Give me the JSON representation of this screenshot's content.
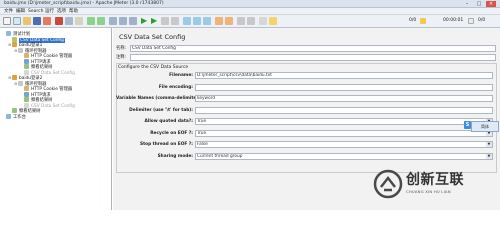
{
  "window": {
    "title": "baidu.jmx (D:\\jmeter_script\\baidu.jmx) - Apache JMeter (3.0 r1743807)"
  },
  "menu": [
    "文件",
    "编辑",
    "Search",
    "运行",
    "选项",
    "帮助"
  ],
  "toolbar": {
    "readout1": "0/0",
    "readout2": "00:00:01",
    "readout3": "0/0"
  },
  "tree": [
    {
      "label": "测试计划",
      "level": 0,
      "expander": "",
      "icon": "#8bb7e6",
      "selected": false,
      "disabled": false
    },
    {
      "label": "CSV Data Set Config",
      "level": 1,
      "expander": "",
      "icon": "#b0c76a",
      "selected": true,
      "disabled": false
    },
    {
      "label": "baidu登录1",
      "level": 1,
      "expander": "⊖",
      "icon": "#e0a23a",
      "selected": false,
      "disabled": false
    },
    {
      "label": "循环控制器",
      "level": 2,
      "expander": "⊖",
      "icon": "#c6c6c6",
      "selected": false,
      "disabled": false
    },
    {
      "label": "HTTP Cookie 管理器",
      "level": 3,
      "expander": "",
      "icon": "#d7b56d",
      "selected": false,
      "disabled": false
    },
    {
      "label": "HTTP请求",
      "level": 3,
      "expander": "",
      "icon": "#7aa1d4",
      "selected": false,
      "disabled": false
    },
    {
      "label": "察看结果树",
      "level": 3,
      "expander": "",
      "icon": "#9cc07a",
      "selected": false,
      "disabled": false
    },
    {
      "label": "CSV Data Set Config",
      "level": 3,
      "expander": "",
      "icon": "#d6d6d6",
      "selected": false,
      "disabled": true
    },
    {
      "label": "baidu登录2",
      "level": 1,
      "expander": "⊖",
      "icon": "#e0a23a",
      "selected": false,
      "disabled": false
    },
    {
      "label": "循环控制器",
      "level": 2,
      "expander": "⊖",
      "icon": "#c6c6c6",
      "selected": false,
      "disabled": false
    },
    {
      "label": "HTTP Cookie 管理器",
      "level": 3,
      "expander": "",
      "icon": "#d7b56d",
      "selected": false,
      "disabled": false
    },
    {
      "label": "HTTP请求",
      "level": 3,
      "expander": "",
      "icon": "#7aa1d4",
      "selected": false,
      "disabled": false
    },
    {
      "label": "察看结果树",
      "level": 3,
      "expander": "",
      "icon": "#9cc07a",
      "selected": false,
      "disabled": false
    },
    {
      "label": "CSV Data Set Config",
      "level": 3,
      "expander": "",
      "icon": "#d6d6d6",
      "selected": false,
      "disabled": true
    },
    {
      "label": "察看结果树",
      "level": 1,
      "expander": "",
      "icon": "#9cc07a",
      "selected": false,
      "disabled": false
    },
    {
      "label": "工作台",
      "level": 0,
      "expander": "",
      "icon": "#8bb7e6",
      "selected": false,
      "disabled": false
    }
  ],
  "panel": {
    "title": "CSV Data Set Config",
    "name_label": "名称:",
    "name_value": "CSV Data Set Config",
    "comment_label": "注释:",
    "comment_value": "",
    "group_title": "Configure the CSV Data Source",
    "fields": [
      {
        "label": "Filename:",
        "value": "D:\\jmeter_script\\csv\\data\\baidu.txt",
        "dropdown": false
      },
      {
        "label": "File encoding:",
        "value": "",
        "dropdown": false
      },
      {
        "label": "Variable Names (comma-delimited):",
        "value": "keyword",
        "dropdown": false
      },
      {
        "label": "Delimiter (use '\\t' for tab):",
        "value": "",
        "dropdown": false
      },
      {
        "label": "Allow quoted data?:",
        "value": "True",
        "dropdown": true
      },
      {
        "label": "Recycle on EOF ?:",
        "value": "True",
        "dropdown": true
      },
      {
        "label": "Stop thread on EOF ?:",
        "value": "False",
        "dropdown": true
      },
      {
        "label": "Sharing mode:",
        "value": "Current thread group",
        "dropdown": true
      }
    ]
  },
  "tooltip": {
    "icon_text": "S",
    "text": "简体"
  },
  "watermark": {
    "brand": "创新互联",
    "sub": "CHUANG XIN HU LIAN"
  }
}
